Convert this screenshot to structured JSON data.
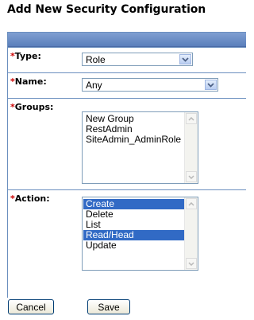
{
  "title": "Add New Security Configuration",
  "required_marker": "*",
  "fields": {
    "type": {
      "label": "Type:",
      "value": "Role"
    },
    "name": {
      "label": "Name:",
      "value": "Any"
    },
    "groups": {
      "label": "Groups:",
      "options": [
        "New Group",
        "RestAdmin",
        "SiteAdmin_AdminRole"
      ]
    },
    "action": {
      "label": "Action:",
      "options": [
        {
          "text": "Create",
          "selected": true
        },
        {
          "text": "Delete",
          "selected": false
        },
        {
          "text": "List",
          "selected": false
        },
        {
          "text": "Read/Head",
          "selected": true
        },
        {
          "text": "Update",
          "selected": false
        }
      ]
    }
  },
  "buttons": {
    "cancel": "Cancel",
    "save": "Save"
  },
  "colors": {
    "header_bar": "#6b8fcb",
    "required": "#cc0000",
    "selection": "#316ac5"
  }
}
